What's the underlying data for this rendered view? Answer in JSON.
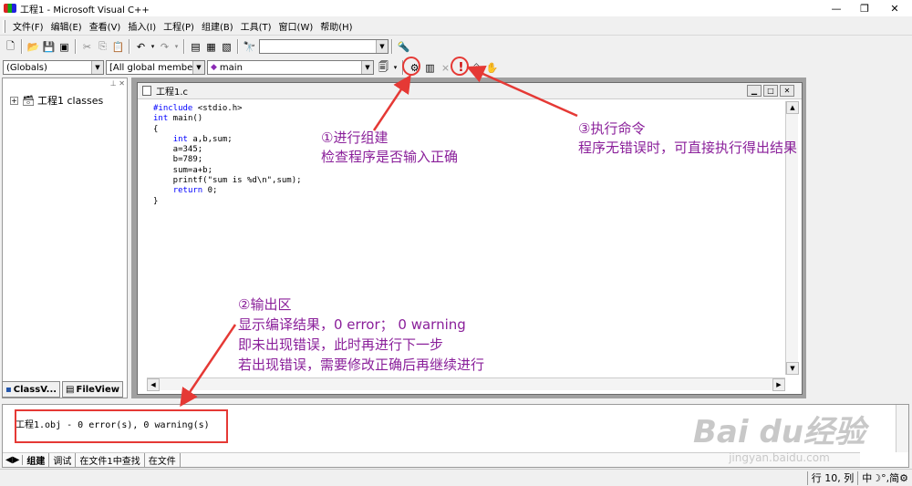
{
  "window": {
    "title": "工程1 - Microsoft Visual C++",
    "controls": {
      "minimize": "—",
      "restore": "❐",
      "close": "✕"
    }
  },
  "menu": [
    "文件(F)",
    "编辑(E)",
    "查看(V)",
    "插入(I)",
    "工程(P)",
    "组建(B)",
    "工具(T)",
    "窗口(W)",
    "帮助(H)"
  ],
  "toolbar": {
    "find_combo_value": "",
    "wizard": {
      "class_combo": "(Globals)",
      "filter_combo": "[All global members",
      "member_combo": "main"
    }
  },
  "workspace": {
    "tree_root": "工程1 classes",
    "tab_classview": "ClassV...",
    "tab_fileview": "FileView"
  },
  "editor": {
    "file_name": "工程1.c",
    "code": [
      {
        "text": "#include <stdio.h>",
        "kw": true
      },
      {
        "text": "int main()",
        "kw": false
      },
      {
        "text": "{",
        "kw": false
      },
      {
        "text": "    int a,b,sum;",
        "kw": false
      },
      {
        "text": "    a=345;",
        "kw": false
      },
      {
        "text": "    b=789;",
        "kw": false
      },
      {
        "text": "    sum=a+b;",
        "kw": false
      },
      {
        "text": "    printf(\"sum is %d\\n\",sum);",
        "kw": false
      },
      {
        "text": "    return 0;",
        "kw": false
      },
      {
        "text": "}",
        "kw": false
      }
    ]
  },
  "output": {
    "text": "工程1.obj - 0 error(s), 0 warning(s)",
    "tabs": [
      "组建",
      "调试",
      "在文件1中查找",
      "在文件"
    ]
  },
  "status": {
    "position": "行 10, 列",
    "ime": "中",
    "ime2": "简"
  },
  "annotations": {
    "build_title": "①进行组建",
    "build_desc": "检查程序是否输入正确",
    "exec_title": "③执行命令",
    "exec_desc": "程序无错误时，可直接执行得出结果",
    "output_title": "②输出区",
    "output_line1": "显示编译结果，0 error；  0 warning",
    "output_line2": "即未出现错误，此时再进行下一步",
    "output_line3": "若出现错误，需要修改正确后再继续进行"
  },
  "watermark": {
    "brand": "Bai du经验",
    "url": "jingyan.baidu.com"
  },
  "colors": {
    "annotation": "#8a1f9a",
    "highlight": "#e53935",
    "keyword": "#0000ff"
  }
}
